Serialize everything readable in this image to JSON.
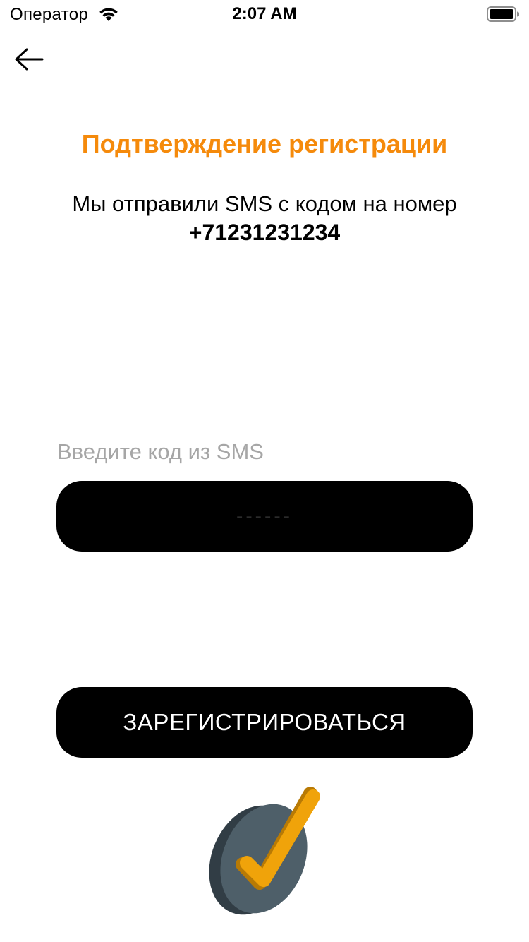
{
  "status_bar": {
    "carrier": "Оператор",
    "time": "2:07 AM",
    "icons": [
      "wifi-icon",
      "battery-icon"
    ]
  },
  "nav": {
    "back_icon": "arrow-left-icon"
  },
  "header": {
    "title": "Подтверждение регистрации",
    "subtitle": "Мы отправили SMS с кодом на номер",
    "phone": "+71231231234"
  },
  "form": {
    "code_label": "Введите код из SMS",
    "code_value": "",
    "code_placeholder": "------",
    "submit_label": "ЗАРЕГИСТРИРОВАТЬСЯ"
  },
  "illustration": {
    "icon": "checkmark-badge-icon"
  },
  "colors": {
    "accent": "#f58a0b",
    "button_bg": "#000000",
    "label_gray": "#a6a6a6",
    "badge_dark": "#4e5f69",
    "check_yellow": "#f0a30a"
  }
}
